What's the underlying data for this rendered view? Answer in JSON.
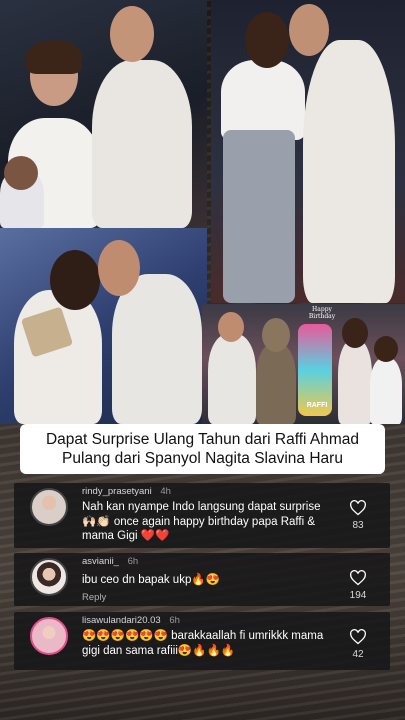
{
  "caption": {
    "line1": "Dapat Surprise Ulang Tahun dari Raffi Ahmad",
    "line2": "Pulang dari Spanyol Nagita Slavina Haru"
  },
  "photo_overlay": {
    "cake_text": "Happy Birthday",
    "cake_name": "RAFFI"
  },
  "comments": [
    {
      "username": "rindy_prasetyani",
      "age": "4h",
      "text": "Nah kan nyampe Indo langsung dapat surprise 🙌🏻👏🏻 once again happy birthday papa Raffi & mama Gigi ❤️❤️",
      "reply_label": "",
      "likes": "83"
    },
    {
      "username": "asvianii_",
      "age": "6h",
      "text": "ibu ceo dn bapak ukp🔥😍",
      "reply_label": "Reply",
      "likes": "194"
    },
    {
      "username": "lisawulandari20.03",
      "age": "6h",
      "text": "😍😍😍😍😍😍 barakkaallah fi umrikkk mama gigi dan sama rafiii😍🔥🔥🔥",
      "reply_label": "",
      "likes": "42"
    }
  ],
  "icons": {
    "like": "heart-outline-icon"
  }
}
